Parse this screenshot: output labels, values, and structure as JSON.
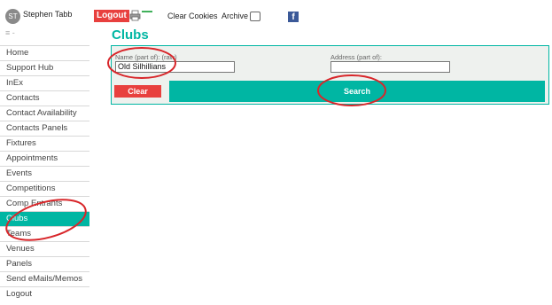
{
  "header": {
    "avatar_initials": "ST",
    "username": "Stephen Tabb",
    "logout_label": "Logout",
    "clear_cookies_label": "Clear Cookies",
    "archive_label": "Archive",
    "archive_checked": false,
    "facebook_glyph": "f",
    "menu_glyph": "≡ -"
  },
  "sidebar": {
    "items": [
      {
        "label": "Home"
      },
      {
        "label": "Support Hub"
      },
      {
        "label": "InEx"
      },
      {
        "label": "Contacts"
      },
      {
        "label": "Contact Availability"
      },
      {
        "label": "Contacts Panels"
      },
      {
        "label": "Fixtures"
      },
      {
        "label": "Appointments"
      },
      {
        "label": "Events"
      },
      {
        "label": "Competitions"
      },
      {
        "label": "Comp Entrants"
      },
      {
        "label": "Clubs",
        "active": true
      },
      {
        "label": "Teams"
      },
      {
        "label": "Venues"
      },
      {
        "label": "Panels"
      },
      {
        "label": "Send eMails/Memos"
      },
      {
        "label": "Logout"
      }
    ]
  },
  "main": {
    "title": "Clubs",
    "search_form": {
      "name_label": "Name (part of): (raw)",
      "name_value": "Old Silhillians",
      "address_label": "Address (part of):",
      "address_value": "",
      "clear_label": "Clear",
      "search_label": "Search"
    }
  },
  "colors": {
    "accent": "#00b6a3",
    "danger": "#e8403e",
    "annotation": "#d8262a"
  },
  "icons": {
    "print": "printer-icon",
    "facebook": "facebook-icon",
    "menu": "hamburger-menu-icon"
  }
}
